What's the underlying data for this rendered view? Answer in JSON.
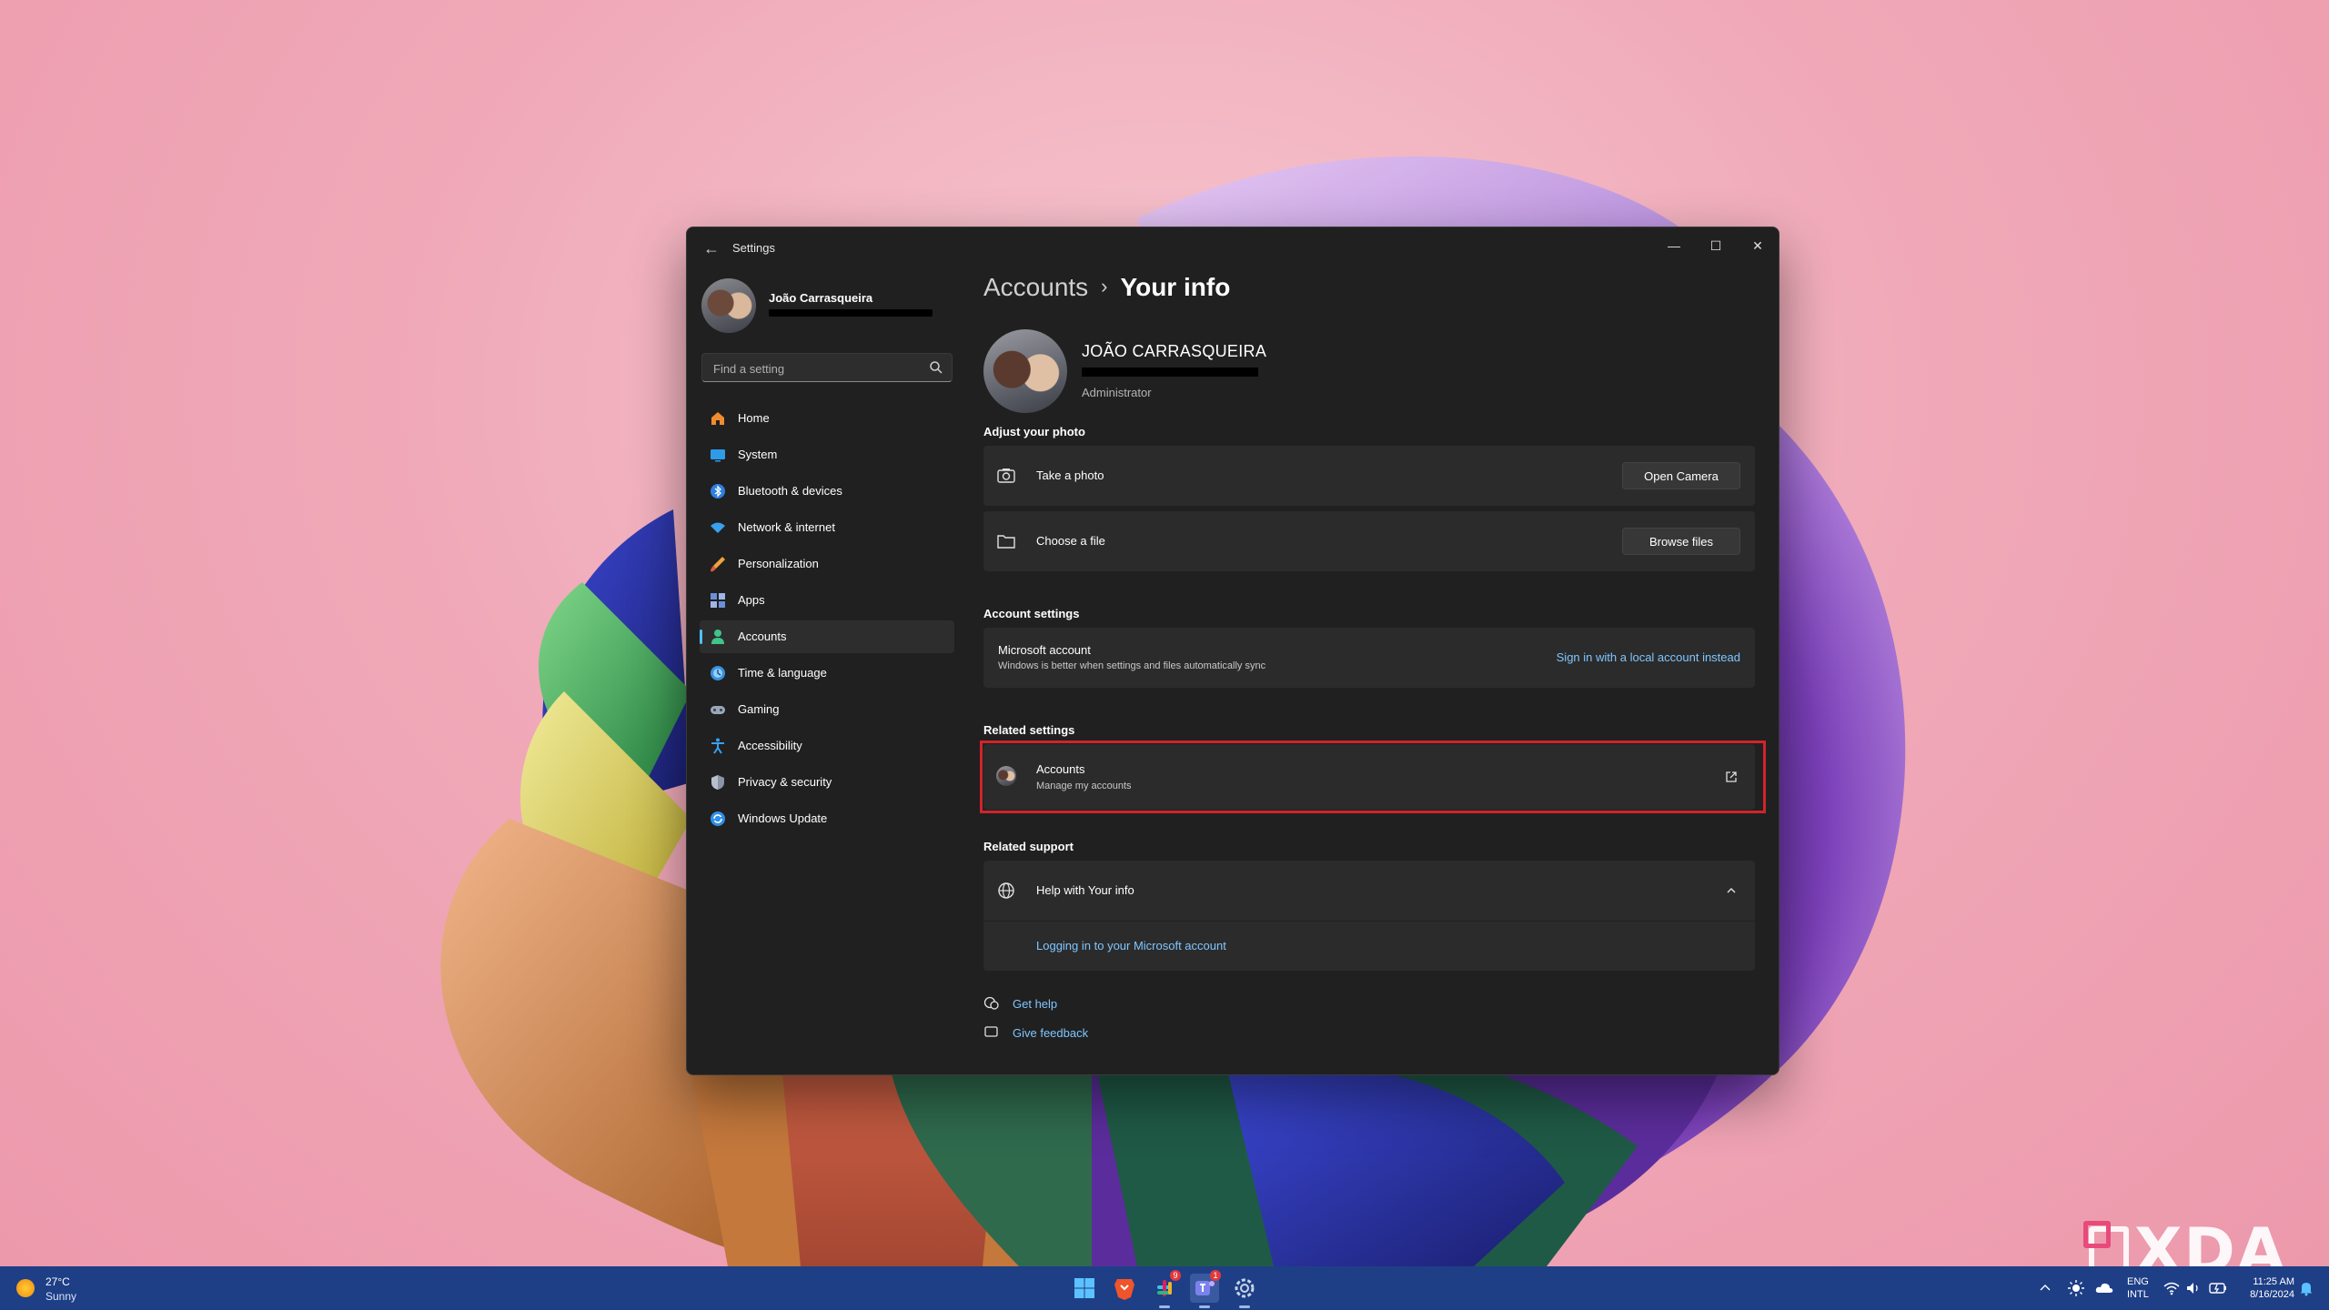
{
  "window": {
    "title": "Settings",
    "minimize": "—",
    "maximize": "☐",
    "close": "✕"
  },
  "sidebar": {
    "profile_name": "João Carrasqueira",
    "search_placeholder": "Find a setting",
    "items": [
      {
        "label": "Home",
        "icon": "home-icon"
      },
      {
        "label": "System",
        "icon": "system-icon"
      },
      {
        "label": "Bluetooth & devices",
        "icon": "bluetooth-icon"
      },
      {
        "label": "Network & internet",
        "icon": "network-icon"
      },
      {
        "label": "Personalization",
        "icon": "personalization-icon"
      },
      {
        "label": "Apps",
        "icon": "apps-icon"
      },
      {
        "label": "Accounts",
        "icon": "accounts-icon",
        "active": true
      },
      {
        "label": "Time & language",
        "icon": "time-language-icon"
      },
      {
        "label": "Gaming",
        "icon": "gaming-icon"
      },
      {
        "label": "Accessibility",
        "icon": "accessibility-icon"
      },
      {
        "label": "Privacy & security",
        "icon": "privacy-icon"
      },
      {
        "label": "Windows Update",
        "icon": "windows-update-icon"
      }
    ]
  },
  "main": {
    "breadcrumb": {
      "parent": "Accounts",
      "separator": "›",
      "current": "Your info"
    },
    "user": {
      "name": "JOÃO CARRASQUEIRA",
      "role": "Administrator"
    },
    "adjust_photo": {
      "title": "Adjust your photo",
      "take_photo": {
        "label": "Take a photo",
        "button": "Open Camera"
      },
      "choose_file": {
        "label": "Choose a file",
        "button": "Browse files"
      }
    },
    "account_settings": {
      "title": "Account settings",
      "microsoft_account": {
        "label": "Microsoft account",
        "description": "Windows is better when settings and files automatically sync",
        "link": "Sign in with a local account instead"
      }
    },
    "related_settings": {
      "title": "Related settings",
      "accounts": {
        "label": "Accounts",
        "description": "Manage my accounts"
      }
    },
    "related_support": {
      "title": "Related support",
      "help": {
        "label": "Help with Your info",
        "link": "Logging in to your Microsoft account"
      }
    },
    "footer": {
      "get_help": "Get help",
      "give_feedback": "Give feedback"
    }
  },
  "taskbar": {
    "weather": {
      "temp": "27°C",
      "condition": "Sunny"
    },
    "apps": [
      {
        "name": "start-button"
      },
      {
        "name": "brave-browser"
      },
      {
        "name": "slack",
        "badge": "9"
      },
      {
        "name": "teams",
        "badge": "1"
      },
      {
        "name": "settings"
      }
    ],
    "language": {
      "line1": "ENG",
      "line2": "INTL"
    },
    "clock": {
      "time": "11:25 AM",
      "date": "8/16/2024"
    }
  },
  "watermark": "XDA",
  "colors": {
    "accent": "#4cc2ff",
    "link": "#7fc6ff",
    "highlight_border": "#d1242a",
    "window_bg": "#202020",
    "card_bg": "#2b2b2b",
    "taskbar_bg": "#1e3f86"
  }
}
